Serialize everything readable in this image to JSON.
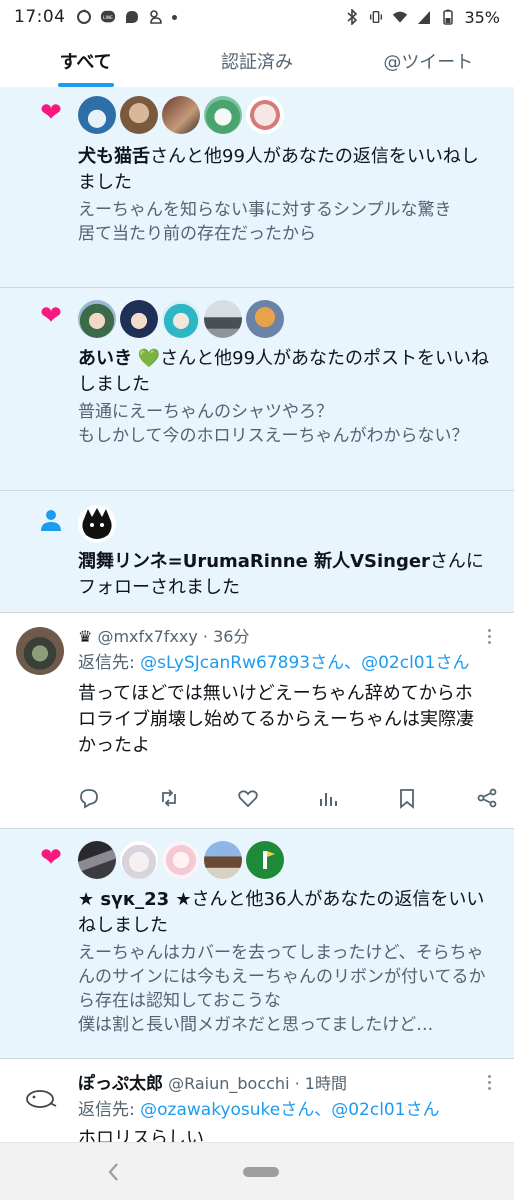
{
  "status_bar": {
    "time": "17:04",
    "battery": "35%",
    "left_icons": [
      "sync-icon",
      "line-app-icon",
      "chat-icon",
      "notification-icon"
    ],
    "right_icons": [
      "bluetooth-icon",
      "vibrate-icon",
      "wifi-icon",
      "signal-icon",
      "battery-icon"
    ]
  },
  "tabs": [
    {
      "label": "すべて",
      "active": true
    },
    {
      "label": "認証済み",
      "active": false
    },
    {
      "label": "@ツイート",
      "active": false
    }
  ],
  "notifications": [
    {
      "type": "like",
      "actor": "犬も猫舌",
      "text": "さんと他99人があなたの返信をいいねしました",
      "quote": [
        "えーちゃんを知らない事に対するシンプルな驚き",
        "居て当たり前の存在だったから"
      ]
    },
    {
      "type": "like",
      "actor": "あいき",
      "actor_emoji": "💚",
      "text": "さんと他99人があなたのポストをいいねしました",
      "quote": [
        "普通にえーちゃんのシャツやろ？",
        "もしかして今のホロリスえーちゃんがわからない？"
      ]
    },
    {
      "type": "follow",
      "actor": "潤舞リンネ=UrumaRinne 新人VSinger",
      "text": "さんにフォローされました"
    },
    {
      "type": "reply",
      "handle_prefix": "♛",
      "handle": "@mxfx7fxxy",
      "time": "· 36分",
      "reply_to_label": "返信先: ",
      "reply_to": "@sLySJcanRw67893さん、@02cl01さん",
      "text": "昔ってほどでは無いけどえーちゃん辞めてからホロライブ崩壊し始めてるからえーちゃんは実際凄かったよ"
    },
    {
      "type": "like",
      "actor": "★ ѕүк_23 ★",
      "text": "さんと他36人があなたの返信をいいねしました",
      "quote": [
        "えーちゃんはカバーを去ってしまったけど、そらちゃんのサインには今もえーちゃんのリボンが付いてるから存在は認知しておこうな",
        "僕は割と長い間メガネだと思ってましたけど…"
      ]
    },
    {
      "type": "reply",
      "name": "ぽっぷ太郎",
      "handle": "@Raiun_bocchi",
      "time": "· 1時間",
      "reply_to_label": "返信先: ",
      "reply_to": "@ozawakyosukeさん、@02cl01さん",
      "text": "ホロリスらしい"
    }
  ],
  "colors": {
    "accent": "#1d9bf0",
    "like": "#f91880",
    "unread_bg": "#e8f5fd",
    "follow_icon": "#1d9bf0"
  }
}
